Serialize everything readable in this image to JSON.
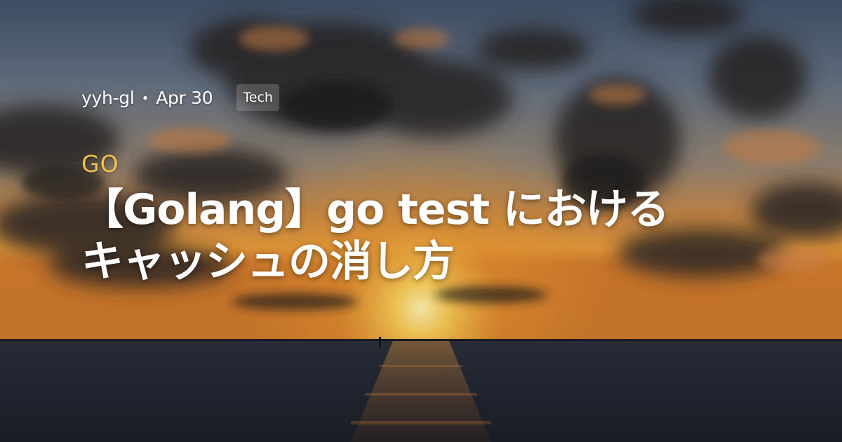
{
  "card": {
    "author": "yyh-gl",
    "separator": "・",
    "date": "Apr 30",
    "tag": "Tech",
    "category": "GO",
    "title_line1": "【Golang】go test における",
    "title_line2": "キャッシュの消し方"
  },
  "colors": {
    "category_accent": "#f2c14e",
    "title_text": "#ffffff",
    "tag_background": "rgba(255,255,255,0.18)"
  },
  "background": {
    "icon": "sunset-over-sea-photo"
  }
}
